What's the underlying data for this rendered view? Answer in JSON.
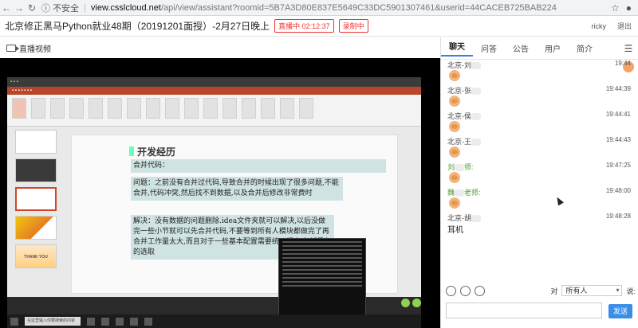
{
  "browser": {
    "secure_label": "不安全",
    "url_host": "view.csslcloud.net",
    "url_path": "/api/view/assistant?roomid=5B7A3D80E837E5649C33DC5901307461&userid=44CACEB725BAB224"
  },
  "header": {
    "title": "北京修正黑马Python就业48期（20191201面授）-2月27日晚上",
    "live_badge": "直播中 02:12:37",
    "rec_badge": "录制中",
    "user": "ricky",
    "logout": "退出"
  },
  "video": {
    "label": "直播视频",
    "slide_title": "开发经历",
    "line1": "合并代码：",
    "line2": "问题：之前没有合并过代码,导致合并的时候出现了很多问题,不能合并,代码冲突,然后找不到数据,以及合并后修改非常费时",
    "line3": "解决：没有数据的问题删除.idea文件夹就可以解决,以后没做完一些小节就可以先合并代码,不要等到所有人模块都做完了再合并工作量太大,而且对于一些基本配置需要统一规定,包括导包的选取",
    "thumb_thanks": "THANK YOU",
    "taskbar_search": "在这里输入你要搜索的内容"
  },
  "chat": {
    "tabs": [
      "聊天",
      "问答",
      "公告",
      "用户",
      "简介"
    ],
    "messages": [
      {
        "name": "北京-刘",
        "time": "19:44",
        "kind": "emoji"
      },
      {
        "name": "北京-张",
        "time": "19:44:39",
        "kind": "emoji"
      },
      {
        "name": "北京-侯",
        "time": "19:44:41",
        "kind": "emoji"
      },
      {
        "name": "北京-王",
        "time": "19:44:43",
        "kind": "emoji"
      },
      {
        "name": "刘",
        "time": "19:47:25",
        "kind": "emoji",
        "green": true,
        "suffix": "师:"
      },
      {
        "name": "魏",
        "time": "19:48:00",
        "kind": "emoji",
        "green": true,
        "suffix": "老师:"
      },
      {
        "name": "北京-胡",
        "time": "19:48:28",
        "kind": "text",
        "text": "耳机"
      }
    ],
    "to_label": "对",
    "to_value": "所有人",
    "cut_label": "说:",
    "send": "发送"
  }
}
